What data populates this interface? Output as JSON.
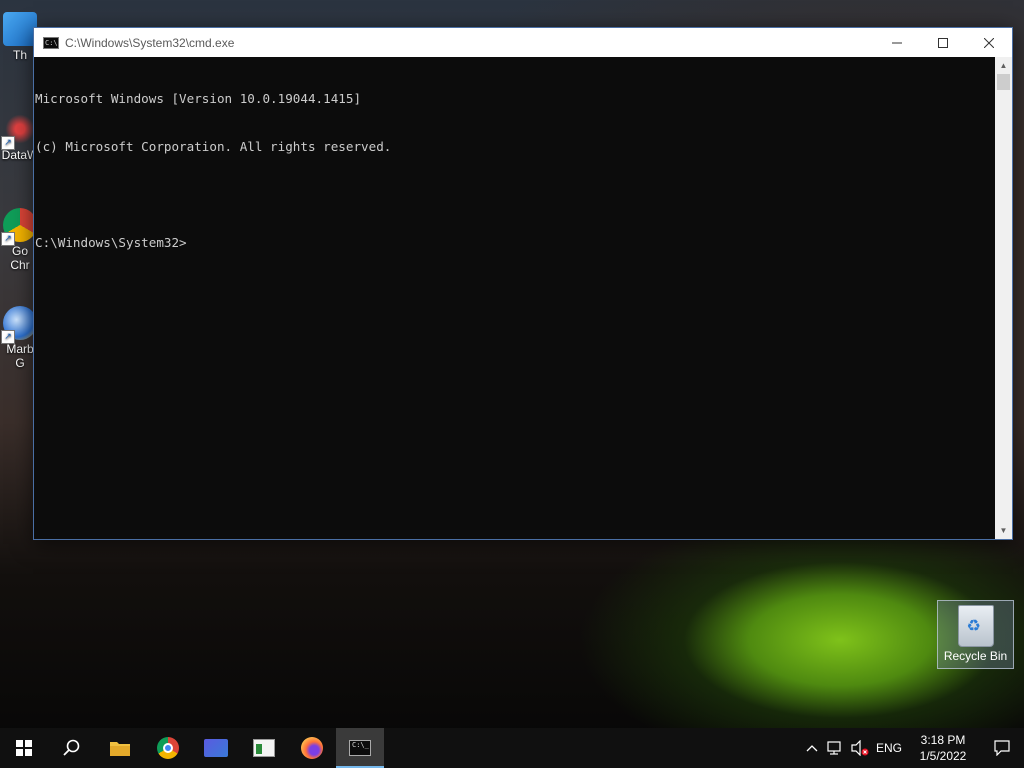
{
  "desktop": {
    "icons": [
      {
        "label": "Th",
        "icon": "this-pc-icon"
      },
      {
        "label": "DataW",
        "icon": "datawrapper-icon"
      },
      {
        "label": "Go\nChr",
        "icon": "chrome-icon"
      },
      {
        "label": "Marb\nG",
        "icon": "marble-icon"
      }
    ],
    "recycle_bin": {
      "label": "Recycle Bin",
      "icon": "recycle-bin-icon"
    }
  },
  "window": {
    "title": "C:\\Windows\\System32\\cmd.exe",
    "console_lines": [
      "Microsoft Windows [Version 10.0.19044.1415]",
      "(c) Microsoft Corporation. All rights reserved.",
      "",
      "C:\\Windows\\System32>"
    ],
    "colors": {
      "background": "#0c0c0c",
      "text": "#cccccc"
    }
  },
  "taskbar": {
    "items": [
      {
        "name": "start",
        "icon": "windows-start-icon"
      },
      {
        "name": "search",
        "icon": "search-icon"
      },
      {
        "name": "file-explorer",
        "icon": "folder-icon"
      },
      {
        "name": "chrome",
        "icon": "chrome-icon"
      },
      {
        "name": "app-blue",
        "icon": "app-icon"
      },
      {
        "name": "app-green",
        "icon": "app-window-icon"
      },
      {
        "name": "firefox",
        "icon": "firefox-icon"
      },
      {
        "name": "cmd",
        "icon": "terminal-icon",
        "active": true
      }
    ],
    "tray": {
      "language": "ENG",
      "time": "3:18 PM",
      "date": "1/5/2022"
    },
    "accent": "#76b9ed"
  }
}
